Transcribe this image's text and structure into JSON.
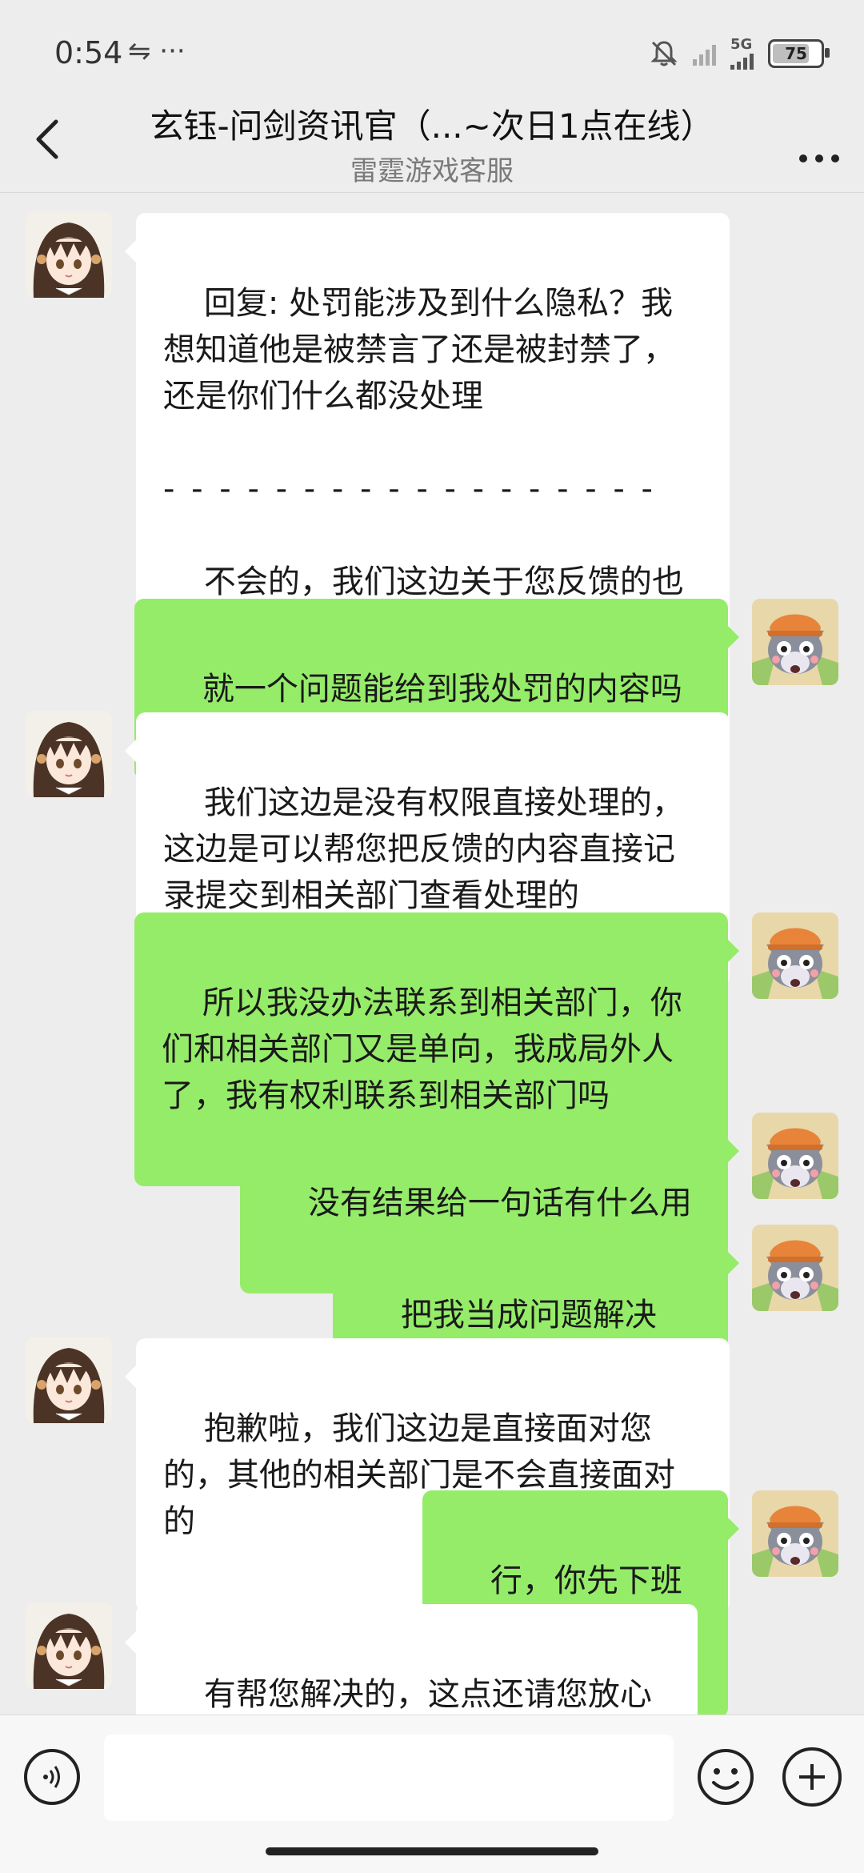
{
  "status": {
    "time": "0:54",
    "left_icons": "⇋ ···",
    "network": "5G",
    "battery": "75"
  },
  "header": {
    "back_icon": "‹",
    "title": "玄钰-问剑资讯官（...~次日1点在线）",
    "subtitle": "雷霆游戏客服",
    "more_icon": "···"
  },
  "messages": [
    {
      "from": "agent",
      "text": "回复: 处罚能涉及到什么隐私？我想知道他是被禁言了还是被封禁了，还是你们什么都没处理",
      "divider": "- - - - - - - - - - - - - - - - - -",
      "text2": "不会的，我们这边关于您反馈的也是会帮您处理的，这个是相关部门处理的"
    },
    {
      "from": "user",
      "text": "就一个问题能给到我处罚的内容吗"
    },
    {
      "from": "agent",
      "text": "我们这边是没有权限直接处理的，这边是可以帮您把反馈的内容直接记录提交到相关部门查看处理的"
    },
    {
      "from": "user",
      "text": "所以我没办法联系到相关部门，你们和相关部门又是单向，我成局外人了，我有权利联系到相关部门吗"
    },
    {
      "from": "user",
      "text": "没有结果给一句话有什么用"
    },
    {
      "from": "user",
      "text": "把我当成问题解决吗?"
    },
    {
      "from": "agent",
      "text": "抱歉啦，我们这边是直接面对您的，其他的相关部门是不会直接面对的"
    },
    {
      "from": "user",
      "text": "行，你先下班吧"
    },
    {
      "from": "agent",
      "text": "有帮您解决的，这点还请您放心"
    }
  ],
  "input": {
    "value": "",
    "placeholder": ""
  },
  "colors": {
    "user_bubble": "#95ec69",
    "agent_bubble": "#ffffff",
    "background": "#ededed"
  }
}
